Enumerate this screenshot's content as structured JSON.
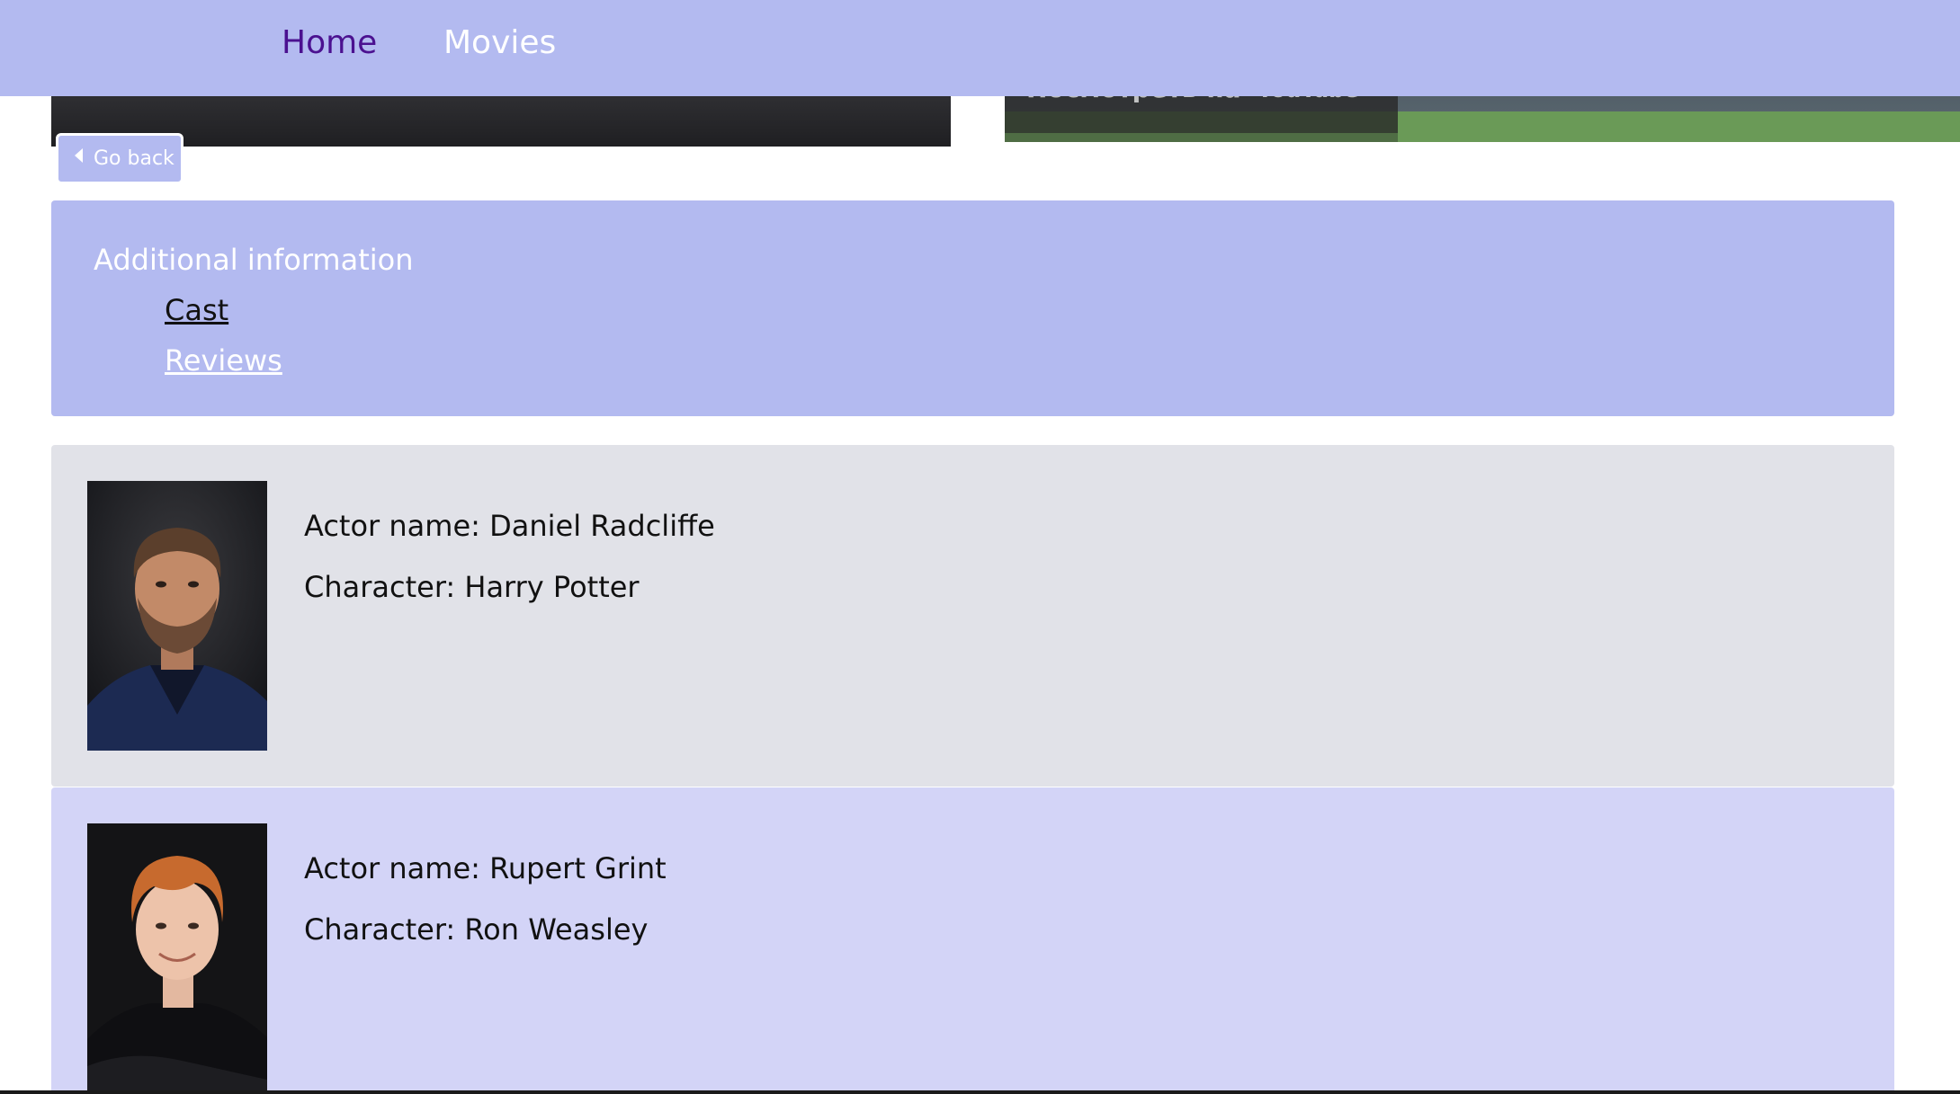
{
  "nav": {
    "home_label": "Home",
    "movies_label": "Movies"
  },
  "video_embeds": {
    "right_watch_on": "Посмотреть на",
    "right_logo": "YouTube"
  },
  "go_back": {
    "label": "Go back"
  },
  "additional_info": {
    "title": "Additional information",
    "cast_label": "Cast",
    "reviews_label": "Reviews"
  },
  "cast": [
    {
      "actor_name": "Actor name: Daniel Radcliffe",
      "character": "Character: Harry Potter"
    },
    {
      "actor_name": "Actor name: Rupert Grint",
      "character": "Character: Ron Weasley"
    }
  ],
  "colors": {
    "accent": "#b3baf0",
    "active_nav": "#4b1190",
    "card_gray": "#e1e2e8",
    "card_lavender": "#d3d4f7"
  }
}
